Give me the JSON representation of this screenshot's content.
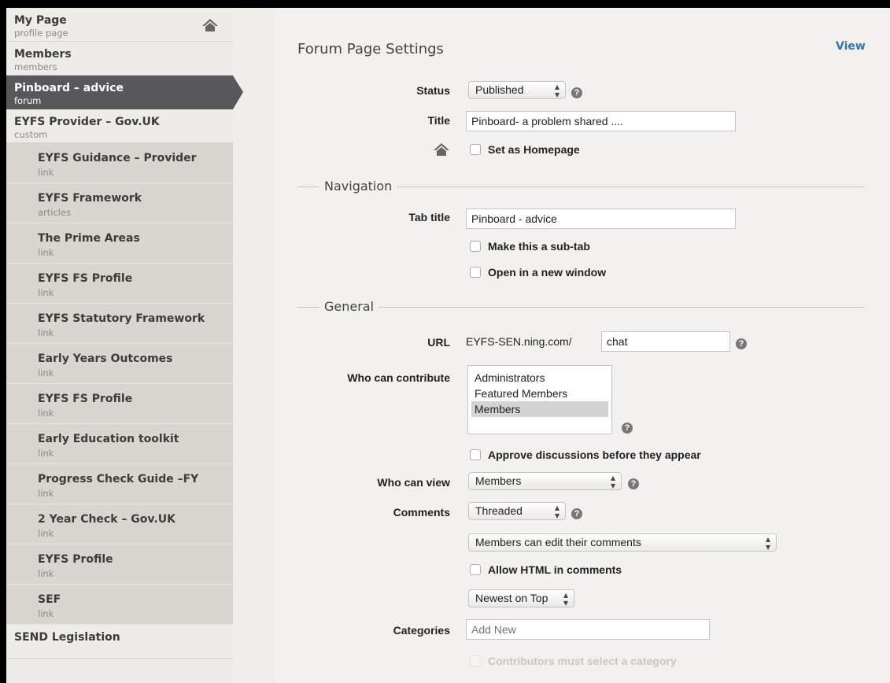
{
  "sidebar": {
    "items": [
      {
        "title": "My Page",
        "sub": "profile page",
        "kind": "top",
        "home": true
      },
      {
        "title": "Members",
        "sub": "members",
        "kind": "top"
      },
      {
        "title": "Pinboard – advice",
        "sub": "forum",
        "kind": "top",
        "active": true
      },
      {
        "title": "EYFS Provider – Gov.UK",
        "sub": "custom",
        "kind": "top"
      },
      {
        "title": "EYFS Guidance – Provider",
        "sub": "link",
        "kind": "child"
      },
      {
        "title": "EYFS Framework",
        "sub": "articles",
        "kind": "child"
      },
      {
        "title": "The Prime Areas",
        "sub": "link",
        "kind": "child"
      },
      {
        "title": "EYFS FS Profile",
        "sub": "link",
        "kind": "child"
      },
      {
        "title": "EYFS Statutory Framework",
        "sub": "link",
        "kind": "child"
      },
      {
        "title": "Early Years Outcomes",
        "sub": "link",
        "kind": "child"
      },
      {
        "title": "EYFS FS Profile",
        "sub": "link",
        "kind": "child"
      },
      {
        "title": "Early Education toolkit",
        "sub": "link",
        "kind": "child"
      },
      {
        "title": "Progress Check Guide –FY",
        "sub": "link",
        "kind": "child"
      },
      {
        "title": "2 Year Check – Gov.UK",
        "sub": "link",
        "kind": "child"
      },
      {
        "title": "EYFS Profile",
        "sub": "link",
        "kind": "child"
      },
      {
        "title": "SEF",
        "sub": "link",
        "kind": "child"
      },
      {
        "title": "SEND Legislation",
        "sub": "",
        "kind": "top"
      }
    ]
  },
  "header": {
    "title": "Forum Page Settings",
    "view_link": "View"
  },
  "form": {
    "status_label": "Status",
    "status_value": "Published",
    "title_label": "Title",
    "title_value": "Pinboard- a problem shared ....",
    "homepage_label": "Set as Homepage",
    "navigation_legend": "Navigation",
    "tab_title_label": "Tab title",
    "tab_title_value": "Pinboard - advice",
    "subtab_label": "Make this a sub-tab",
    "newwindow_label": "Open in a new window",
    "general_legend": "General",
    "url_label": "URL",
    "url_prefix": "EYFS-SEN.ning.com/",
    "url_value": "chat",
    "contribute_label": "Who can contribute",
    "contribute_options": [
      "Administrators",
      "Featured Members",
      "Members"
    ],
    "contribute_selected": "Members",
    "approve_label": "Approve discussions before they appear",
    "view_label": "Who can view",
    "view_value": "Members",
    "comments_label": "Comments",
    "comments_value": "Threaded",
    "edit_comments_value": "Members can edit their comments",
    "html_label": "Allow HTML in comments",
    "order_value": "Newest on Top",
    "categories_label": "Categories",
    "categories_placeholder": "Add New",
    "must_select_label": "Contributors must select a category"
  },
  "colors": {
    "accent_link": "#3573a8",
    "active_item": "#58585a"
  },
  "icons": {
    "home": "home-icon",
    "help": "help-icon",
    "select_arrows": "updown-arrows-icon"
  }
}
